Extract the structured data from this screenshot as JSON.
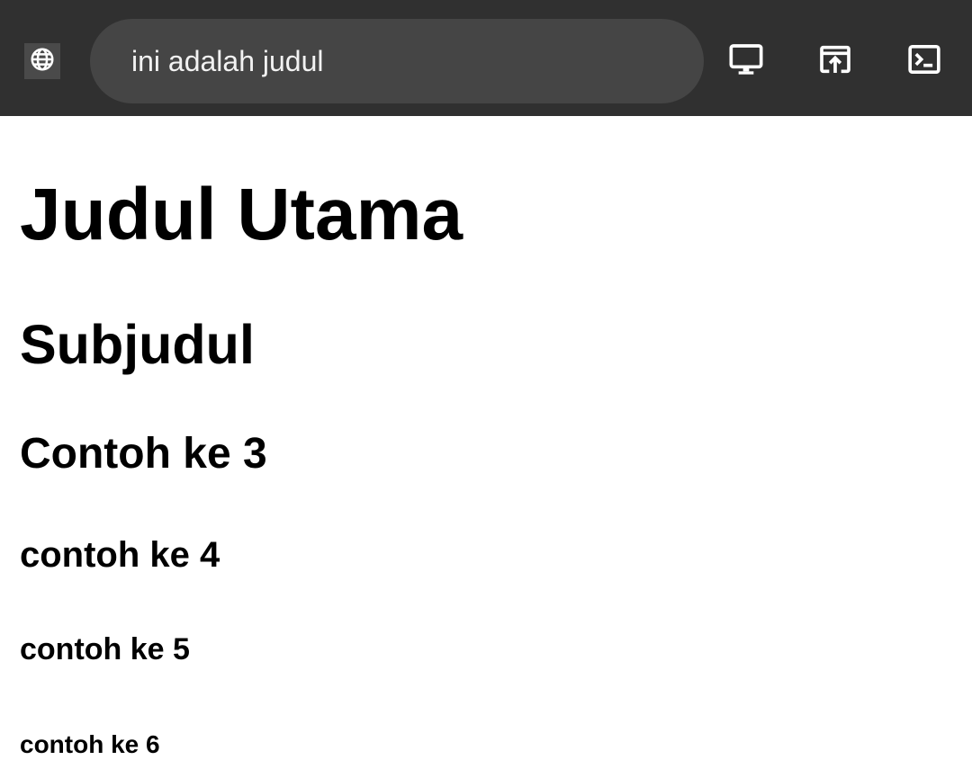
{
  "toolbar": {
    "url_text": "ini adalah judul",
    "icons": [
      "globe-icon",
      "desktop-icon",
      "open-in-new-icon",
      "terminal-icon"
    ],
    "background_color": "#303030",
    "pill_color": "#454545"
  },
  "page": {
    "headings": {
      "h1": "Judul Utama",
      "h2": "Subjudul",
      "h3": "Contoh ke 3",
      "h4": "contoh ke 4",
      "h5": "contoh ke 5",
      "h6": "contoh ke 6"
    }
  }
}
